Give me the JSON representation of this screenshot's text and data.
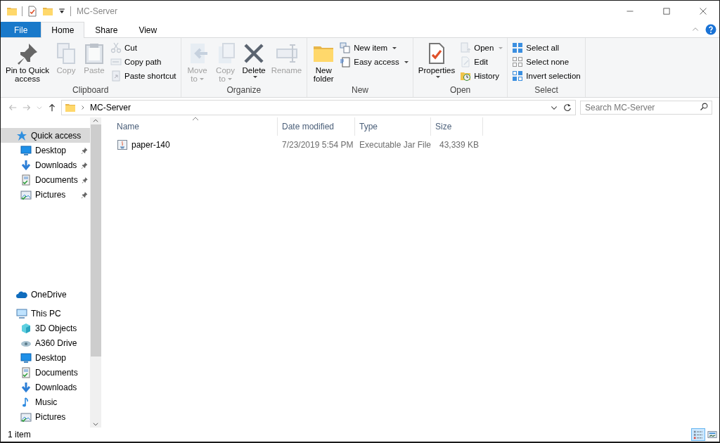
{
  "window": {
    "title": "MC-Server"
  },
  "tabs": [
    {
      "label": "File",
      "kind": "file",
      "selected": false
    },
    {
      "label": "Home",
      "kind": "tab",
      "selected": true
    },
    {
      "label": "Share",
      "kind": "tab",
      "selected": false
    },
    {
      "label": "View",
      "kind": "tab",
      "selected": false
    }
  ],
  "ribbon": {
    "groups": [
      {
        "label": "Clipboard",
        "items": [
          {
            "kind": "large",
            "label": "Pin to Quick\naccess",
            "disabled": false
          },
          {
            "kind": "large",
            "label": "Copy",
            "disabled": true
          },
          {
            "kind": "large",
            "label": "Paste",
            "disabled": true
          },
          {
            "kind": "small",
            "label": "Cut",
            "disabled": true
          },
          {
            "kind": "small",
            "label": "Copy path",
            "disabled": true
          },
          {
            "kind": "small",
            "label": "Paste shortcut",
            "disabled": true
          }
        ]
      },
      {
        "label": "Organize",
        "items": [
          {
            "kind": "large",
            "label": "Move\nto",
            "disabled": true,
            "dropdown": true
          },
          {
            "kind": "large",
            "label": "Copy\nto",
            "disabled": true,
            "dropdown": true
          },
          {
            "kind": "large",
            "label": "Delete",
            "disabled": false,
            "dropdown": true
          },
          {
            "kind": "large",
            "label": "Rename",
            "disabled": true
          }
        ]
      },
      {
        "label": "New",
        "items": [
          {
            "kind": "large",
            "label": "New\nfolder",
            "disabled": false
          },
          {
            "kind": "small",
            "label": "New item",
            "disabled": false,
            "dropdown": true
          },
          {
            "kind": "small",
            "label": "Easy access",
            "disabled": false,
            "dropdown": true
          }
        ]
      },
      {
        "label": "Open",
        "items": [
          {
            "kind": "large",
            "label": "Properties",
            "disabled": false,
            "dropdown": true
          },
          {
            "kind": "small",
            "label": "Open",
            "disabled": true,
            "dropdown": true
          },
          {
            "kind": "small",
            "label": "Edit",
            "disabled": true
          },
          {
            "kind": "small",
            "label": "History",
            "disabled": false
          }
        ]
      },
      {
        "label": "Select",
        "items": [
          {
            "kind": "small",
            "label": "Select all",
            "disabled": false
          },
          {
            "kind": "small",
            "label": "Select none",
            "disabled": false
          },
          {
            "kind": "small",
            "label": "Invert selection",
            "disabled": false
          }
        ]
      }
    ]
  },
  "address_bar": {
    "path": "MC-Server",
    "search": {
      "placeholder": "Search MC-Server"
    }
  },
  "navigation": [
    {
      "label": "Quick access",
      "selected": true,
      "children": [
        {
          "label": "Desktop",
          "pinned": true,
          "selected": false
        },
        {
          "label": "Downloads",
          "pinned": true,
          "selected": false
        },
        {
          "label": "Documents",
          "pinned": true,
          "selected": false
        },
        {
          "label": "Pictures",
          "pinned": true,
          "selected": false
        }
      ]
    },
    {
      "label": "OneDrive",
      "selected": false
    },
    {
      "label": "This PC",
      "selected": false,
      "children": [
        {
          "label": "3D Objects",
          "pinned": false,
          "selected": false
        },
        {
          "label": "A360 Drive",
          "pinned": false,
          "selected": false
        },
        {
          "label": "Desktop",
          "pinned": false,
          "selected": false
        },
        {
          "label": "Documents",
          "pinned": false,
          "selected": false
        },
        {
          "label": "Downloads",
          "pinned": false,
          "selected": false
        },
        {
          "label": "Music",
          "pinned": false,
          "selected": false
        },
        {
          "label": "Pictures",
          "pinned": false,
          "selected": false
        }
      ]
    }
  ],
  "file_list": {
    "columns": [
      {
        "label": "Name",
        "sorted": true
      },
      {
        "label": "Date modified",
        "sorted": false
      },
      {
        "label": "Type",
        "sorted": false
      },
      {
        "label": "Size",
        "sorted": false
      }
    ],
    "rows": [
      {
        "cells": [
          "paper-140",
          "7/23/2019 5:54 PM",
          "Executable Jar File",
          "43,339 KB"
        ]
      }
    ]
  },
  "status_bar": {
    "item_count": "1 item",
    "views": [
      {
        "kind": "details",
        "selected": true
      },
      {
        "kind": "large-icons",
        "selected": false
      }
    ]
  }
}
